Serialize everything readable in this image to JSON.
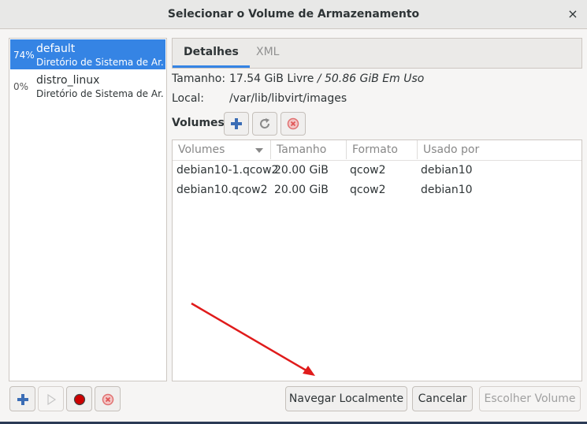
{
  "window": {
    "title": "Selecionar o Volume de Armazenamento",
    "close_glyph": "×"
  },
  "pools": [
    {
      "percent": "74%",
      "name": "default",
      "subtitle": "Diretório de Sistema de Ar...",
      "selected": true
    },
    {
      "percent": "0%",
      "name": "distro_linux",
      "subtitle": "Diretório de Sistema de Ar...",
      "selected": false
    }
  ],
  "tabs": [
    {
      "label": "Detalhes",
      "active": true
    },
    {
      "label": "XML",
      "active": false
    }
  ],
  "details": {
    "size_label": "Tamanho:",
    "size_free": "17.54 GiB Livre",
    "size_sep": " / ",
    "size_used": "50.86 GiB Em Uso",
    "location_label": "Local:",
    "location_value": "/var/lib/libvirt/images",
    "volumes_label": "Volumes"
  },
  "table": {
    "columns": [
      "Volumes",
      "Tamanho",
      "Formato",
      "Usado por"
    ],
    "rows": [
      [
        "debian10-1.qcow2",
        "20.00 GiB",
        "qcow2",
        "debian10"
      ],
      [
        "debian10.qcow2",
        "20.00 GiB",
        "qcow2",
        "debian10"
      ]
    ]
  },
  "buttons": {
    "browse_local": "Navegar Localmente",
    "cancel": "Cancelar",
    "choose_volume": "Escolher Volume"
  },
  "colors": {
    "accent": "#3584e4",
    "annotation_arrow": "#e01b1b",
    "stop_red": "#cc0000"
  }
}
